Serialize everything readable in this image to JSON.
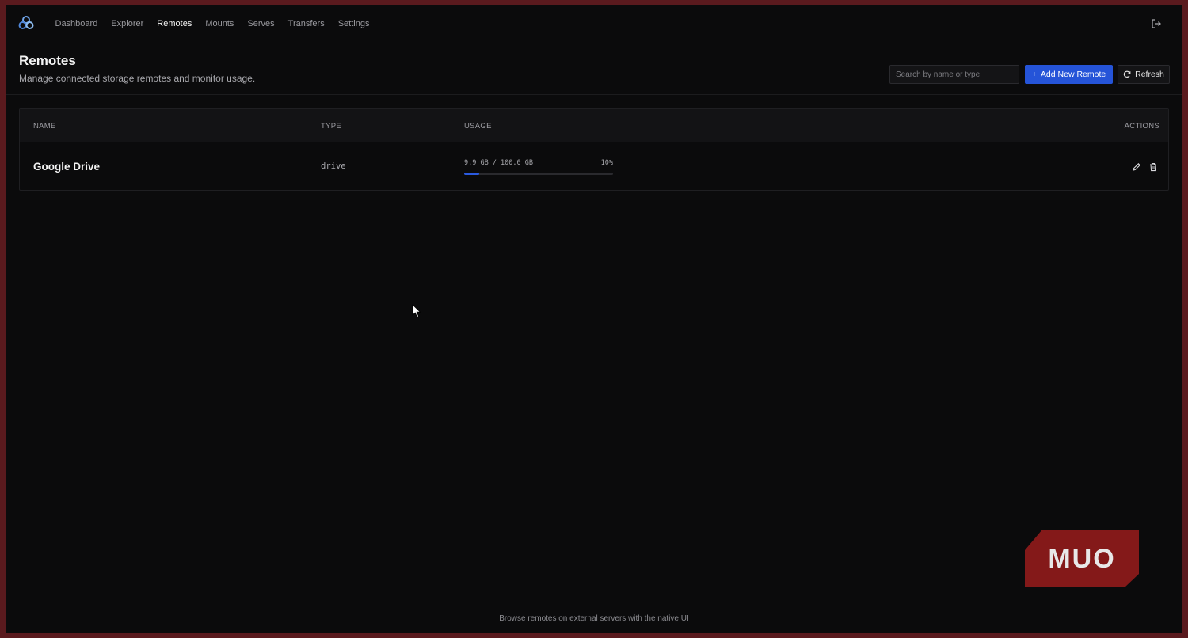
{
  "nav": {
    "items": [
      {
        "label": "Dashboard",
        "active": false
      },
      {
        "label": "Explorer",
        "active": false
      },
      {
        "label": "Remotes",
        "active": true
      },
      {
        "label": "Mounts",
        "active": false
      },
      {
        "label": "Serves",
        "active": false
      },
      {
        "label": "Transfers",
        "active": false
      },
      {
        "label": "Settings",
        "active": false
      }
    ]
  },
  "header": {
    "title": "Remotes",
    "subtitle": "Manage connected storage remotes and monitor usage.",
    "search_placeholder": "Search by name or type",
    "add_label": "Add New Remote",
    "refresh_label": "Refresh"
  },
  "table": {
    "columns": [
      "NAME",
      "TYPE",
      "USAGE",
      "ACTIONS"
    ],
    "rows": [
      {
        "name": "Google Drive",
        "type": "drive",
        "usage_text": "9.9 GB / 100.0 GB",
        "usage_percent_text": "10%",
        "usage_fraction": 0.099
      }
    ]
  },
  "footer": {
    "text": "Browse remotes on external servers with the native UI"
  },
  "watermark": {
    "text": "MUO"
  },
  "colors": {
    "accent": "#2554d8",
    "frame": "#5a1a1e",
    "background": "#0b0b0c"
  }
}
